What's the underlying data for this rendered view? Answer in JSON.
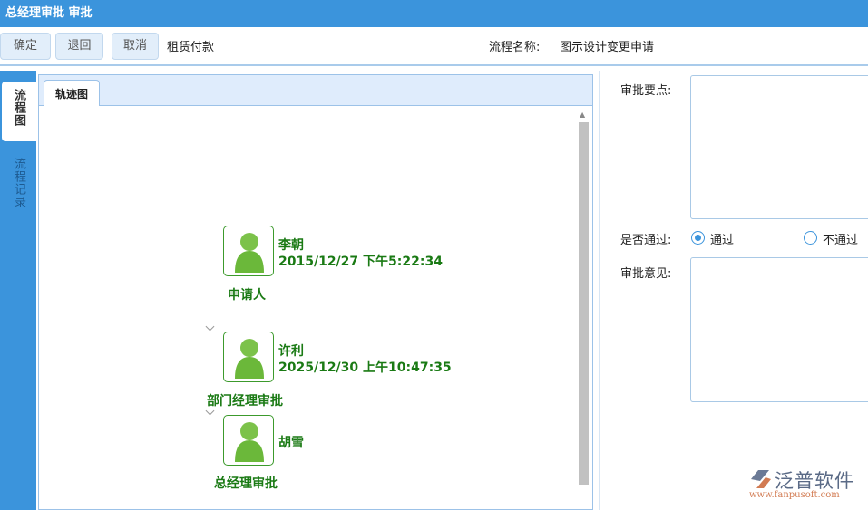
{
  "title": "总经理审批 审批",
  "toolbar": {
    "confirm": "确定",
    "return": "退回",
    "cancel": "取消",
    "doc_name": "租赁付款",
    "flow_label": "流程名称:",
    "flow_name": "图示设计变更申请"
  },
  "sidebar": {
    "tabs": [
      {
        "label": "流程图",
        "active": true
      },
      {
        "label": "流程记录",
        "active": false
      }
    ]
  },
  "panel": {
    "tab": "轨迹图"
  },
  "flow": [
    {
      "name": "李朝",
      "time": "2015/12/27 下午5:22:34",
      "role": "申请人"
    },
    {
      "name": "许利",
      "time": "2025/12/30 上午10:47:35",
      "role": "部门经理审批"
    },
    {
      "name": "胡雪",
      "time": "",
      "role": "总经理审批"
    }
  ],
  "form": {
    "points_label": "审批要点:",
    "points_value": "",
    "pass_label": "是否通过:",
    "options": [
      {
        "label": "通过",
        "selected": true
      },
      {
        "label": "不通过",
        "selected": false
      }
    ],
    "opinion_label": "审批意见:",
    "opinion_value": ""
  },
  "logo": {
    "cn": "泛普软件",
    "url": "www.fanpusoft.com"
  },
  "colors": {
    "accent": "#3b94dc",
    "node_green": "#1a7a14"
  }
}
